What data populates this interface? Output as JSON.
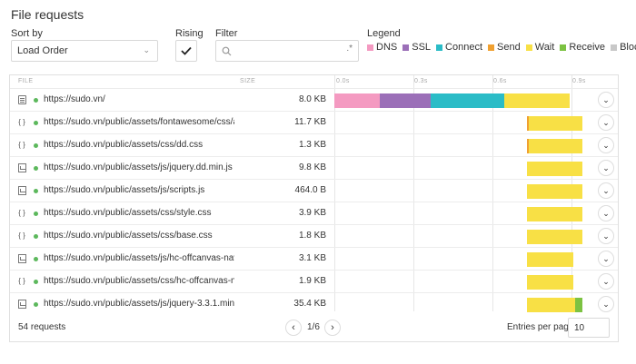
{
  "title": "File requests",
  "sort": {
    "label": "Sort by",
    "value": "Load Order"
  },
  "rising": {
    "label": "Rising",
    "checked": true
  },
  "filter": {
    "label": "Filter",
    "value": "",
    "placeholder": ""
  },
  "legend": {
    "label": "Legend",
    "items": [
      {
        "name": "DNS",
        "color": "#f49ac1"
      },
      {
        "name": "SSL",
        "color": "#9b6fb8"
      },
      {
        "name": "Connect",
        "color": "#2bbcc7"
      },
      {
        "name": "Send",
        "color": "#f0a030"
      },
      {
        "name": "Wait",
        "color": "#f8e045"
      },
      {
        "name": "Receive",
        "color": "#7cc242"
      },
      {
        "name": "Blocked",
        "color": "#c8c8c8"
      }
    ]
  },
  "table": {
    "headers": {
      "file": "FILE",
      "size": "SIZE"
    },
    "ticks": [
      "0.0s",
      "0.3s",
      "0.6s",
      "0.9s"
    ],
    "rows": [
      {
        "icon": "document-icon",
        "url": "https://sudo.vn/",
        "size": "8.0 KB",
        "timings": [
          {
            "phase": "DNS",
            "start": 0.0,
            "end": 0.183
          },
          {
            "phase": "SSL",
            "start": 0.183,
            "end": 0.386
          },
          {
            "phase": "Connect",
            "start": 0.386,
            "end": 0.679
          },
          {
            "phase": "Wait",
            "start": 0.679,
            "end": 0.943
          }
        ]
      },
      {
        "icon": "css-icon",
        "url": "https://sudo.vn/public/assets/fontawesome/css/all....",
        "size": "11.7 KB",
        "timings": [
          {
            "phase": "Send",
            "start": 0.77,
            "end": 0.778
          },
          {
            "phase": "Wait",
            "start": 0.778,
            "end": 0.994
          }
        ]
      },
      {
        "icon": "css-icon",
        "url": "https://sudo.vn/public/assets/css/dd.css",
        "size": "1.3 KB",
        "timings": [
          {
            "phase": "Send",
            "start": 0.77,
            "end": 0.778
          },
          {
            "phase": "Wait",
            "start": 0.778,
            "end": 0.994
          }
        ]
      },
      {
        "icon": "script-icon",
        "url": "https://sudo.vn/public/assets/js/jquery.dd.min.js",
        "size": "9.8 KB",
        "timings": [
          {
            "phase": "Wait",
            "start": 0.77,
            "end": 0.994
          }
        ]
      },
      {
        "icon": "script-icon",
        "url": "https://sudo.vn/public/assets/js/scripts.js",
        "size": "464.0 B",
        "timings": [
          {
            "phase": "Wait",
            "start": 0.77,
            "end": 0.994
          }
        ]
      },
      {
        "icon": "css-icon",
        "url": "https://sudo.vn/public/assets/css/style.css",
        "size": "3.9 KB",
        "timings": [
          {
            "phase": "Wait",
            "start": 0.77,
            "end": 0.994
          }
        ]
      },
      {
        "icon": "css-icon",
        "url": "https://sudo.vn/public/assets/css/base.css",
        "size": "1.8 KB",
        "timings": [
          {
            "phase": "Wait",
            "start": 0.77,
            "end": 0.994
          }
        ]
      },
      {
        "icon": "script-icon",
        "url": "https://sudo.vn/public/assets/js/hc-offcanvas-nav....",
        "size": "3.1 KB",
        "timings": [
          {
            "phase": "Wait",
            "start": 0.77,
            "end": 0.957
          }
        ]
      },
      {
        "icon": "css-icon",
        "url": "https://sudo.vn/public/assets/css/hc-offcanvas-nav....",
        "size": "1.9 KB",
        "timings": [
          {
            "phase": "Wait",
            "start": 0.77,
            "end": 0.957
          }
        ]
      },
      {
        "icon": "script-icon",
        "url": "https://sudo.vn/public/assets/js/jquery-3.3.1.min....",
        "size": "35.4 KB",
        "timings": [
          {
            "phase": "Wait",
            "start": 0.77,
            "end": 0.962
          },
          {
            "phase": "Receive",
            "start": 0.962,
            "end": 0.994
          }
        ]
      }
    ]
  },
  "footer": {
    "count": "54 requests",
    "page": "1/6",
    "entries_label": "Entries per page:",
    "entries_value": "10"
  }
}
